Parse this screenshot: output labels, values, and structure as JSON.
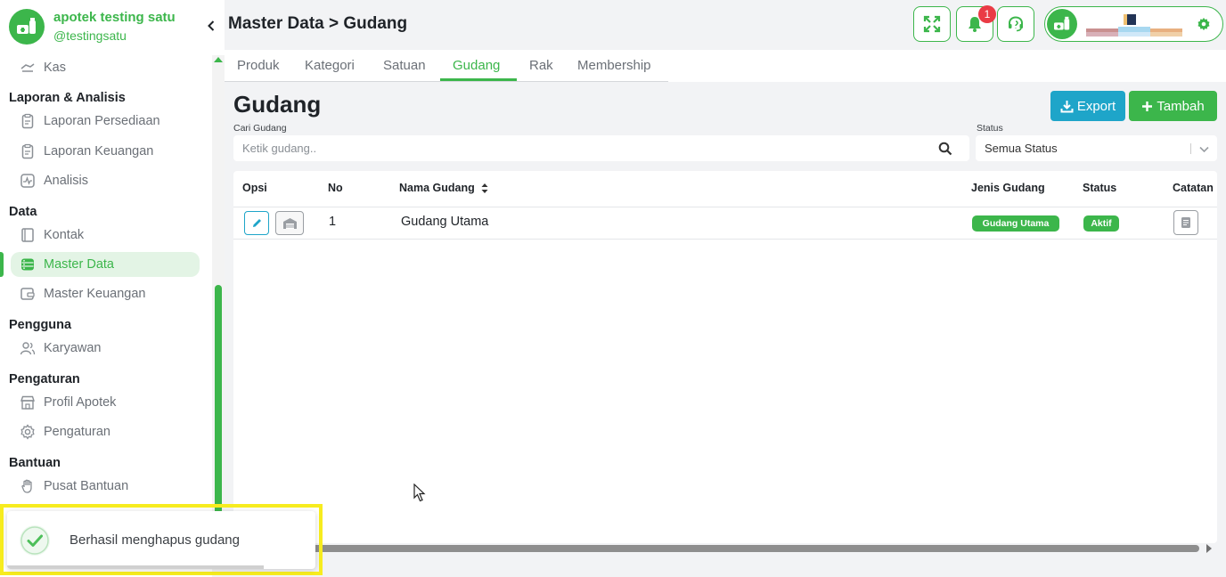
{
  "sidebar": {
    "brand_name": "apotek testing satu",
    "brand_user": "@testingsatu",
    "items": [
      {
        "label": "Kas"
      },
      {
        "section": "Laporan & Analisis"
      },
      {
        "label": "Laporan Persediaan"
      },
      {
        "label": "Laporan Keuangan"
      },
      {
        "label": "Analisis"
      },
      {
        "section": "Data"
      },
      {
        "label": "Kontak"
      },
      {
        "label": "Master Data"
      },
      {
        "label": "Master Keuangan"
      },
      {
        "section": "Pengguna"
      },
      {
        "label": "Karyawan"
      },
      {
        "section": "Pengaturan"
      },
      {
        "label": "Profil Apotek"
      },
      {
        "label": "Pengaturan"
      },
      {
        "section": "Bantuan"
      },
      {
        "label": "Pusat Bantuan"
      }
    ]
  },
  "header": {
    "title": "Master Data > Gudang",
    "notification_count": "1"
  },
  "tabs": [
    "Produk",
    "Kategori",
    "Satuan",
    "Gudang",
    "Rak",
    "Membership"
  ],
  "main": {
    "heading": "Gudang",
    "export_label": "Export",
    "tambah_label": "Tambah",
    "search_label": "Cari Gudang",
    "search_placeholder": "Ketik gudang..",
    "status_label": "Status",
    "status_value": "Semua Status"
  },
  "table": {
    "columns": [
      "Opsi",
      "No",
      "Nama Gudang",
      "Jenis Gudang",
      "Status",
      "Catatan"
    ],
    "rows": [
      {
        "no": "1",
        "nama": "Gudang Utama",
        "jenis": "Gudang Utama",
        "status": "Aktif"
      }
    ]
  },
  "toast": {
    "message": "Berhasil menghapus gudang"
  },
  "colors": {
    "primary": "#3cb64b",
    "export": "#1ea5c9",
    "badge": "#ea3b45",
    "highlight": "#f7ec1f"
  }
}
